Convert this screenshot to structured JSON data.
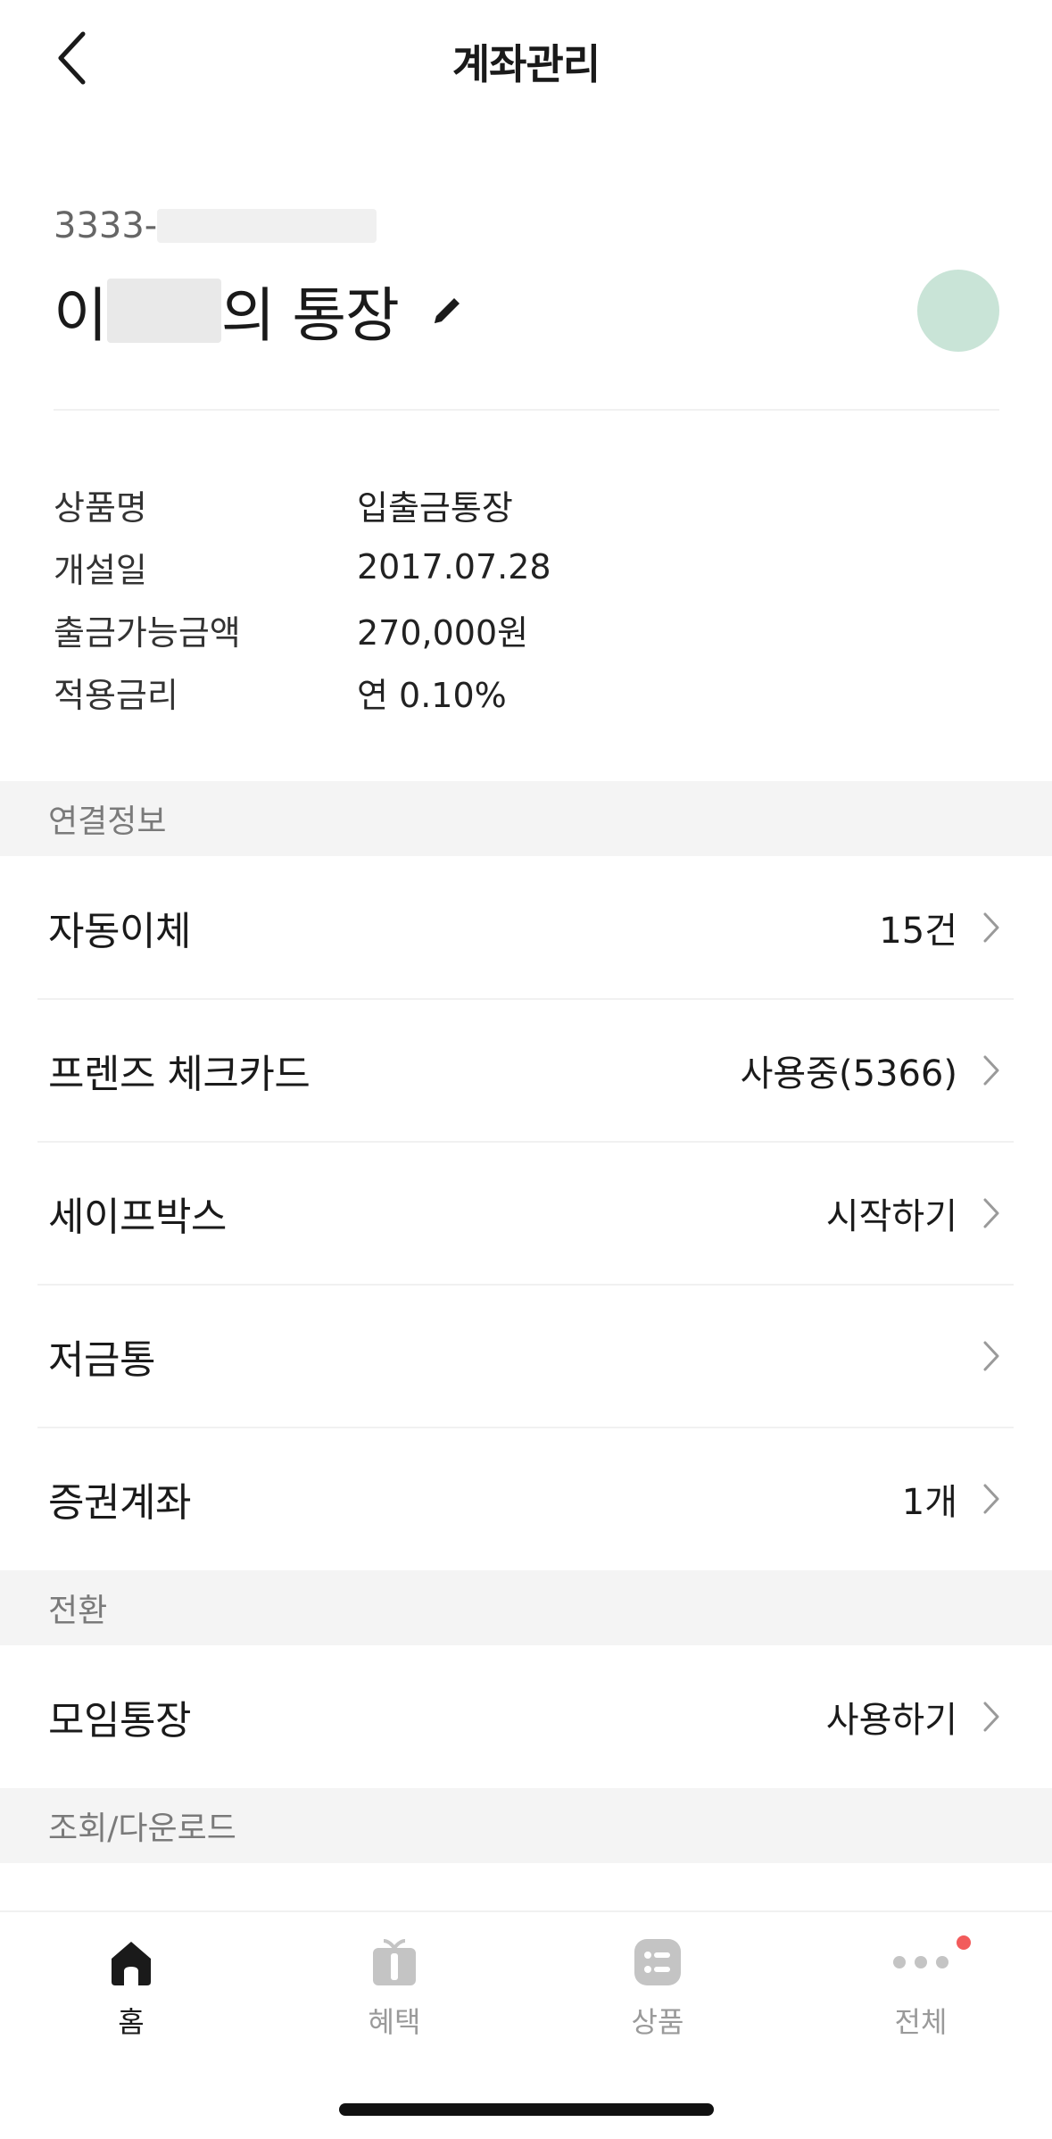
{
  "header": {
    "title": "계좌관리"
  },
  "account": {
    "number_prefix": "3333-",
    "name_prefix": "이",
    "name_suffix": "의 통장"
  },
  "info": [
    {
      "label": "상품명",
      "value": "입출금통장"
    },
    {
      "label": "개설일",
      "value": "2017.07.28"
    },
    {
      "label": "출금가능금액",
      "value": "270,000원"
    },
    {
      "label": "적용금리",
      "value": "연 0.10%"
    }
  ],
  "sections": {
    "linked": "연결정보",
    "convert": "전환",
    "lookup": "조회/다운로드"
  },
  "linked_items": [
    {
      "label": "자동이체",
      "value": "15건"
    },
    {
      "label": "프렌즈 체크카드",
      "value": "사용중(5366)"
    },
    {
      "label": "세이프박스",
      "value": "시작하기"
    },
    {
      "label": "저금통",
      "value": ""
    },
    {
      "label": "증권계좌",
      "value": "1개"
    }
  ],
  "convert_items": [
    {
      "label": "모임통장",
      "value": "사용하기"
    }
  ],
  "tabs": [
    {
      "label": "홈",
      "icon": "home-icon"
    },
    {
      "label": "혜택",
      "icon": "gift-icon"
    },
    {
      "label": "상품",
      "icon": "list-icon"
    },
    {
      "label": "전체",
      "icon": "more-icon"
    }
  ],
  "colors": {
    "profile": "#c9e4d7",
    "badge": "#f25b5b",
    "active": "#1a1a1a",
    "inactive": "#9a9a9a"
  }
}
